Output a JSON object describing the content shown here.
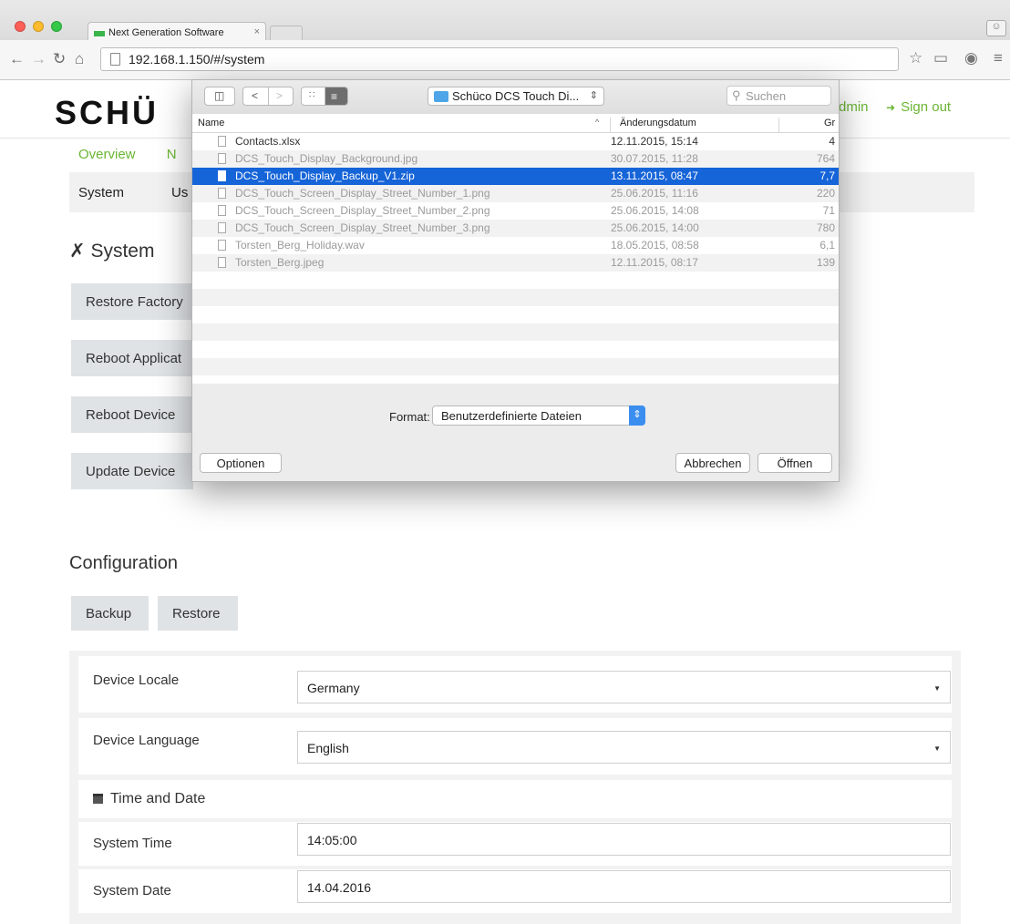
{
  "browser": {
    "tab_title": "Next Generation Software",
    "tab_close": "×",
    "url": "192.168.1.150/#/system",
    "icons": [
      "back-icon",
      "forward-icon",
      "reload-icon",
      "home-icon",
      "star-icon",
      "cast-icon",
      "extension-icon",
      "menu-icon"
    ]
  },
  "header": {
    "logo": "SCHÜ",
    "admin_fragment": "dmin",
    "signout": "Sign out"
  },
  "nav": {
    "main": [
      "Overview",
      "N"
    ],
    "sub": [
      "System",
      "Us"
    ]
  },
  "system": {
    "heading": "System",
    "buttons": [
      "Restore Factory",
      "Reboot Applicat",
      "Reboot Device",
      "Update Device"
    ]
  },
  "configuration": {
    "heading": "Configuration",
    "backup": "Backup",
    "restore": "Restore"
  },
  "settings": {
    "locale_label": "Device Locale",
    "locale_value": "Germany",
    "language_label": "Device Language",
    "language_value": "English",
    "time_date_heading": "Time and Date",
    "time_label": "System Time",
    "time_value": "14:05:00",
    "date_label": "System Date",
    "date_value": "14.04.2016"
  },
  "dialog": {
    "folder": "Schüco DCS Touch Di...",
    "search_placeholder": "Suchen",
    "columns": {
      "name": "Name",
      "date": "Änderungsdatum",
      "size": "Gr"
    },
    "files": [
      {
        "name": "Contacts.xlsx",
        "date": "12.11.2015, 15:14",
        "size": "4",
        "enabled": true,
        "selected": false
      },
      {
        "name": "DCS_Touch_Display_Background.jpg",
        "date": "30.07.2015, 11:28",
        "size": "764",
        "enabled": false,
        "selected": false
      },
      {
        "name": "DCS_Touch_Display_Backup_V1.zip",
        "date": "13.11.2015, 08:47",
        "size": "7,7",
        "enabled": true,
        "selected": true
      },
      {
        "name": "DCS_Touch_Screen_Display_Street_Number_1.png",
        "date": "25.06.2015, 11:16",
        "size": "220",
        "enabled": false,
        "selected": false
      },
      {
        "name": "DCS_Touch_Screen_Display_Street_Number_2.png",
        "date": "25.06.2015, 14:08",
        "size": "71",
        "enabled": false,
        "selected": false
      },
      {
        "name": "DCS_Touch_Screen_Display_Street_Number_3.png",
        "date": "25.06.2015, 14:00",
        "size": "780",
        "enabled": false,
        "selected": false
      },
      {
        "name": "Torsten_Berg_Holiday.wav",
        "date": "18.05.2015, 08:58",
        "size": "6,1",
        "enabled": false,
        "selected": false
      },
      {
        "name": "Torsten_Berg.jpeg",
        "date": "12.11.2015, 08:17",
        "size": "139",
        "enabled": false,
        "selected": false
      }
    ],
    "format_label": "Format:",
    "format_value": "Benutzerdefinierte Dateien",
    "options": "Optionen",
    "cancel": "Abbrechen",
    "open": "Öffnen"
  },
  "colors": {
    "accent_green": "#6ab534",
    "selection_blue": "#1564d8",
    "button_gray": "#dfe3e6"
  }
}
